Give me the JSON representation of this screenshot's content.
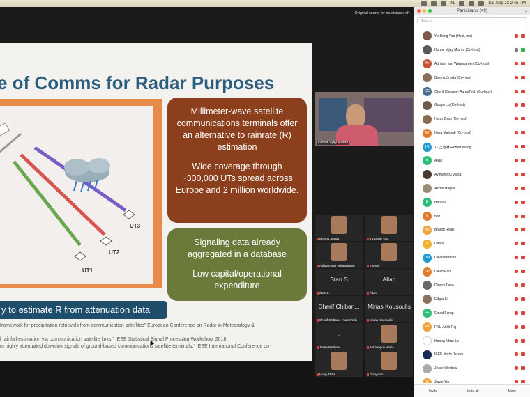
{
  "menubar": {
    "clock": "Sat Sep 13  2:45 PM",
    "battery": "41"
  },
  "meeting": {
    "original_sound": "Original sound for musicians: off"
  },
  "slide": {
    "title": "e of Comms for Radar Purposes",
    "box1": [
      "Millimeter-wave satellite communications terminals offer an alternative to rainrate (R) estimation",
      "Wide coverage through ~300,000 UTs spread across Europe and 2 million worldwide."
    ],
    "box2": [
      "Signaling data already aggregated in a database",
      "Low capital/operational expenditure"
    ],
    "banner": "y to estimate R from attenuation data",
    "refs": [
      "framework for precipitation retrievals from communication satellites” European Conference on Radar in Meteorology &",
      "l rainfall estimation via communication satellite links,” IEEE Statistical Signal Processing Workshop, 2018.",
      "m highly attenuated downlink signals of ground-based communications satellite terminals,” IEEE International Conference on"
    ],
    "ut_labels": [
      "UT3",
      "UT2",
      "UT1"
    ]
  },
  "speaker": {
    "name": "Kumar Vijay Mishra"
  },
  "gallery": [
    {
      "name": "Besma Smida",
      "big": ""
    },
    {
      "name": "Yu-Dong Yao",
      "big": ""
    },
    {
      "name": "Adriaan van Wijngaarden",
      "big": ""
    },
    {
      "name": "msnew",
      "big": ""
    },
    {
      "name": "Stan S",
      "big": "Stan S"
    },
    {
      "name": "Allan",
      "big": "Allan"
    },
    {
      "name": "Cherif Chibane- AuresTech",
      "big": "Cherif Chiban..."
    },
    {
      "name": "Minas Kousoulis",
      "big": "Minas Kousoulis"
    },
    {
      "name": "Jesse Werbow",
      "big": "."
    },
    {
      "name": "Avimanyou Vatsa",
      "big": ""
    },
    {
      "name": "Hong Zhao",
      "big": ""
    },
    {
      "name": "Guoyu Lu",
      "big": ""
    }
  ],
  "participants": {
    "title": "Participants (49)",
    "search_placeholder": "Search",
    "list": [
      {
        "initials": "",
        "name": "Yu-Dong Yao (Host, me)",
        "color": "#7a5a48"
      },
      {
        "initials": "",
        "name": "Kumar Vijay Mishra (Co-host)",
        "color": "#5a5a5a"
      },
      {
        "initials": "Av",
        "name": "Adriaan van Wijngaarden (Co-host)",
        "color": "#c2553a"
      },
      {
        "initials": "",
        "name": "Besma Smida (Co-host)",
        "color": "#8a6c5a"
      },
      {
        "initials": "CC",
        "name": "Cherif Chibane- AuresTech (Co-host)",
        "color": "#4b6b8c"
      },
      {
        "initials": "",
        "name": "Guoyu Lu (Co-host)",
        "color": "#6b5a4a"
      },
      {
        "initials": "",
        "name": "Hong Zhao (Co-host)",
        "color": "#8c6a50"
      },
      {
        "initials": "IM",
        "name": "Ifana Mahbub (Co-host)",
        "color": "#e07b2a"
      },
      {
        "initials": "1R",
        "name": "11-王春林 Robert Wang",
        "color": "#1e9bd1"
      },
      {
        "initials": "A",
        "name": "Allan",
        "color": "#2ec07a"
      },
      {
        "initials": "",
        "name": "Avimanyou Vatsa",
        "color": "#4a3a30"
      },
      {
        "initials": "",
        "name": "Azizul Haque",
        "color": "#9a8a7a"
      },
      {
        "initials": "B",
        "name": "Baohua",
        "color": "#2ec07a"
      },
      {
        "initials": "b",
        "name": "ben",
        "color": "#e07b2a"
      },
      {
        "initials": "BR",
        "name": "Brandt Ryan",
        "color": "#f0a23a"
      },
      {
        "initials": "D",
        "name": "Dania",
        "color": "#f0b030"
      },
      {
        "initials": "DM",
        "name": "David Millman",
        "color": "#1e9bd1"
      },
      {
        "initials": "DP",
        "name": "David Padi",
        "color": "#e07b2a"
      },
      {
        "initials": "",
        "name": "Dinesh Dera",
        "color": "#6a6a6a"
      },
      {
        "initials": "",
        "name": "Edgar Li",
        "color": "#8a7060"
      },
      {
        "initials": "EF",
        "name": "Emad Farag",
        "color": "#2ec07a"
      },
      {
        "initials": "FA",
        "name": "FNU Ankit Raj",
        "color": "#f0a23a"
      },
      {
        "initials": "",
        "name": "Hoang Nhan Le",
        "color": "#ffffff"
      },
      {
        "initials": "",
        "name": "IEEE North Jersey",
        "color": "#1b2c55"
      },
      {
        "initials": "",
        "name": "Jesse Werbow",
        "color": "#aaaaaa"
      },
      {
        "initials": "JY",
        "name": "Jiawe Yin",
        "color": "#f0a23a"
      }
    ],
    "footer": {
      "invite": "Invite",
      "mute_all": "Mute all",
      "more": "More"
    }
  }
}
